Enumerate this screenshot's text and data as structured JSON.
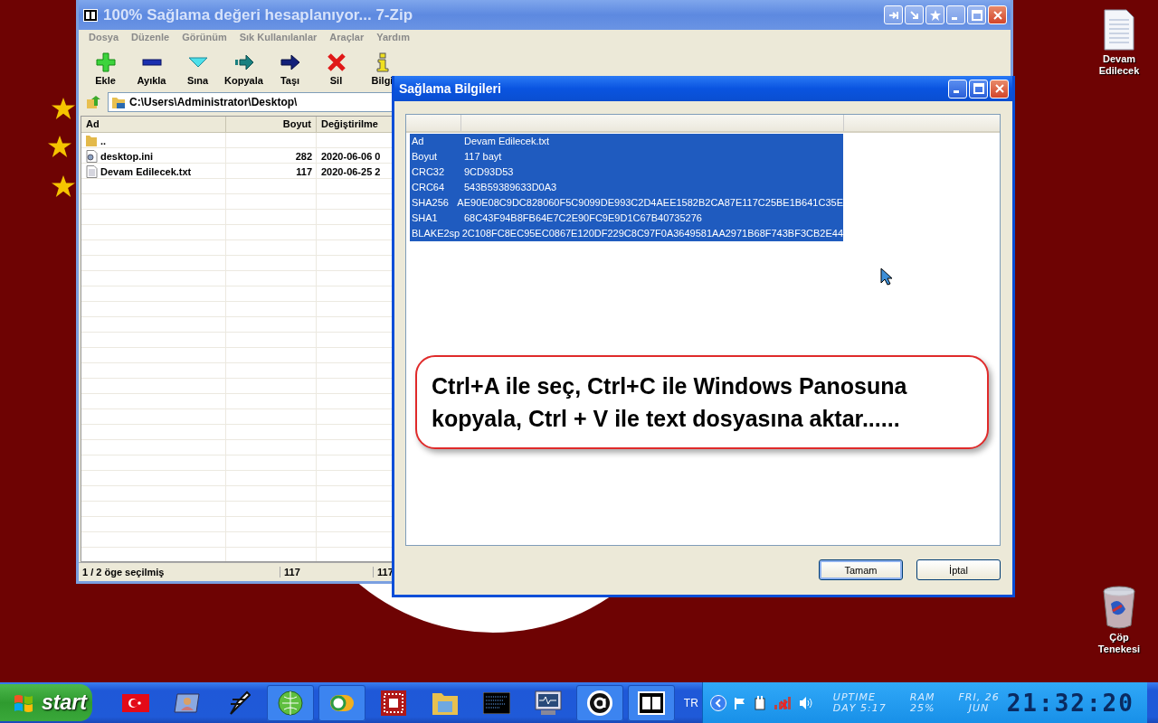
{
  "desktop_icons": [
    {
      "label": "Devam Edilecek",
      "kind": "document"
    },
    {
      "label": "Çöp Tenekesi",
      "kind": "recycle"
    }
  ],
  "main_window": {
    "title": "100% Sağlama değeri hesaplanıyor... 7-Zip",
    "menu": [
      "Dosya",
      "Düzenle",
      "Görünüm",
      "Sık Kullanılanlar",
      "Araçlar",
      "Yardım"
    ],
    "toolbar": [
      {
        "label": "Ekle",
        "kind": "add"
      },
      {
        "label": "Ayıkla",
        "kind": "extract"
      },
      {
        "label": "Sına",
        "kind": "test"
      },
      {
        "label": "Kopyala",
        "kind": "copy"
      },
      {
        "label": "Taşı",
        "kind": "move"
      },
      {
        "label": "Sil",
        "kind": "delete"
      },
      {
        "label": "Bilgi",
        "kind": "info"
      }
    ],
    "address": "C:\\Users\\Administrator\\Desktop\\",
    "columns": [
      "Ad",
      "Boyut",
      "Değiştirilme"
    ],
    "rows": [
      {
        "name": "..",
        "kind": "folder"
      },
      {
        "name": "desktop.ini",
        "size": "282",
        "modified": "2020-06-06 0",
        "kind": "settings"
      },
      {
        "name": "Devam Edilecek.txt",
        "size": "117",
        "modified": "2020-06-25 2",
        "kind": "text"
      }
    ],
    "status_bar": [
      "1 / 2 öge seçilmiş",
      "117",
      "117"
    ]
  },
  "dialog": {
    "title": "Sağlama Bilgileri",
    "rows": [
      {
        "label": "Ad",
        "value": "Devam Edilecek.txt",
        "selected": true
      },
      {
        "label": "Boyut",
        "value": "117 bayt",
        "selected": true
      },
      {
        "label": "CRC32",
        "value": "9CD93D53",
        "selected": true
      },
      {
        "label": "CRC64",
        "value": "543B59389633D0A3",
        "selected": true
      },
      {
        "label": "SHA256",
        "value": "AE90E08C9DC828060F5C9099DE993C2D4AEE1582B2CA87E117C25BE1B641C35E",
        "selected": true
      },
      {
        "label": "SHA1",
        "value": "68C43F94B8FB64E7C2E90FC9E9D1C67B40735276",
        "selected": true
      },
      {
        "label": "BLAKE2sp",
        "value": "2C108FC8EC95EC0867E120DF229C8C97F0A3649581AA2971B68F743BF3CB2E44",
        "selected": true
      }
    ],
    "callout": "Ctrl+A ile seç, Ctrl+C ile Windows Panosuna kopyala, Ctrl + V ile text dosyasına aktar......",
    "buttons": [
      {
        "label": "Tamam",
        "default": true
      },
      {
        "label": "İptal",
        "default": false
      }
    ]
  },
  "taskbar": {
    "start": "start",
    "buttons": [
      {
        "kind": "flag",
        "active": false
      },
      {
        "kind": "user",
        "active": false
      },
      {
        "kind": "pen",
        "active": false
      },
      {
        "kind": "globe",
        "active": true
      },
      {
        "kind": "toggle",
        "active": true
      },
      {
        "kind": "grid",
        "active": false
      },
      {
        "kind": "folder",
        "active": false
      },
      {
        "kind": "terminal",
        "active": false
      },
      {
        "kind": "monitor",
        "active": false
      },
      {
        "kind": "at",
        "active": true
      },
      {
        "kind": "archive",
        "active": true
      }
    ],
    "language": "TR",
    "uptime": [
      "UPTIME",
      "DAY 5:17"
    ],
    "ram": [
      "RAM",
      "25%"
    ],
    "date": [
      "FRI, 26",
      "JUN"
    ],
    "clock": "21:32:20"
  }
}
